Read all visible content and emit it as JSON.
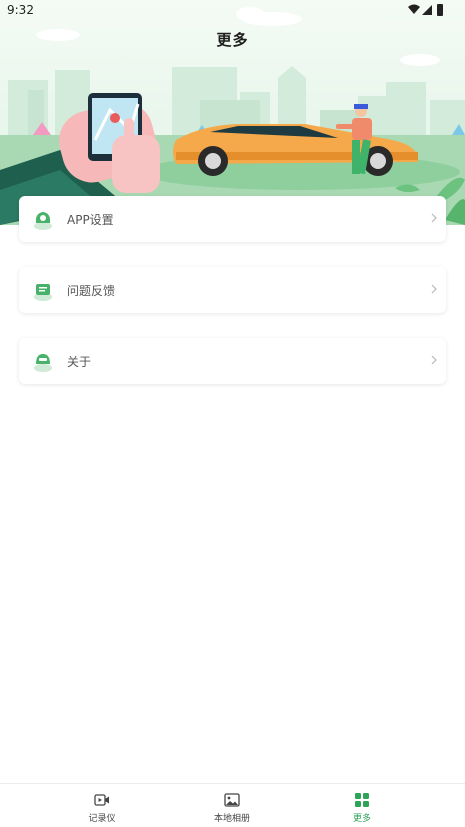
{
  "status_bar": {
    "time": "9:32"
  },
  "header": {
    "title": "更多"
  },
  "menu": {
    "items": [
      {
        "label": "APP设置"
      },
      {
        "label": "问题反馈"
      },
      {
        "label": "关于"
      }
    ]
  },
  "bottom_nav": {
    "items": [
      {
        "label": "记录仪",
        "icon": "video-icon"
      },
      {
        "label": "本地相册",
        "icon": "image-icon"
      },
      {
        "label": "更多",
        "icon": "grid-icon",
        "active": true
      }
    ]
  },
  "colors": {
    "accent": "#2fa35a",
    "car": "#f5a94a",
    "hero_bg": "#e6f5ea"
  }
}
